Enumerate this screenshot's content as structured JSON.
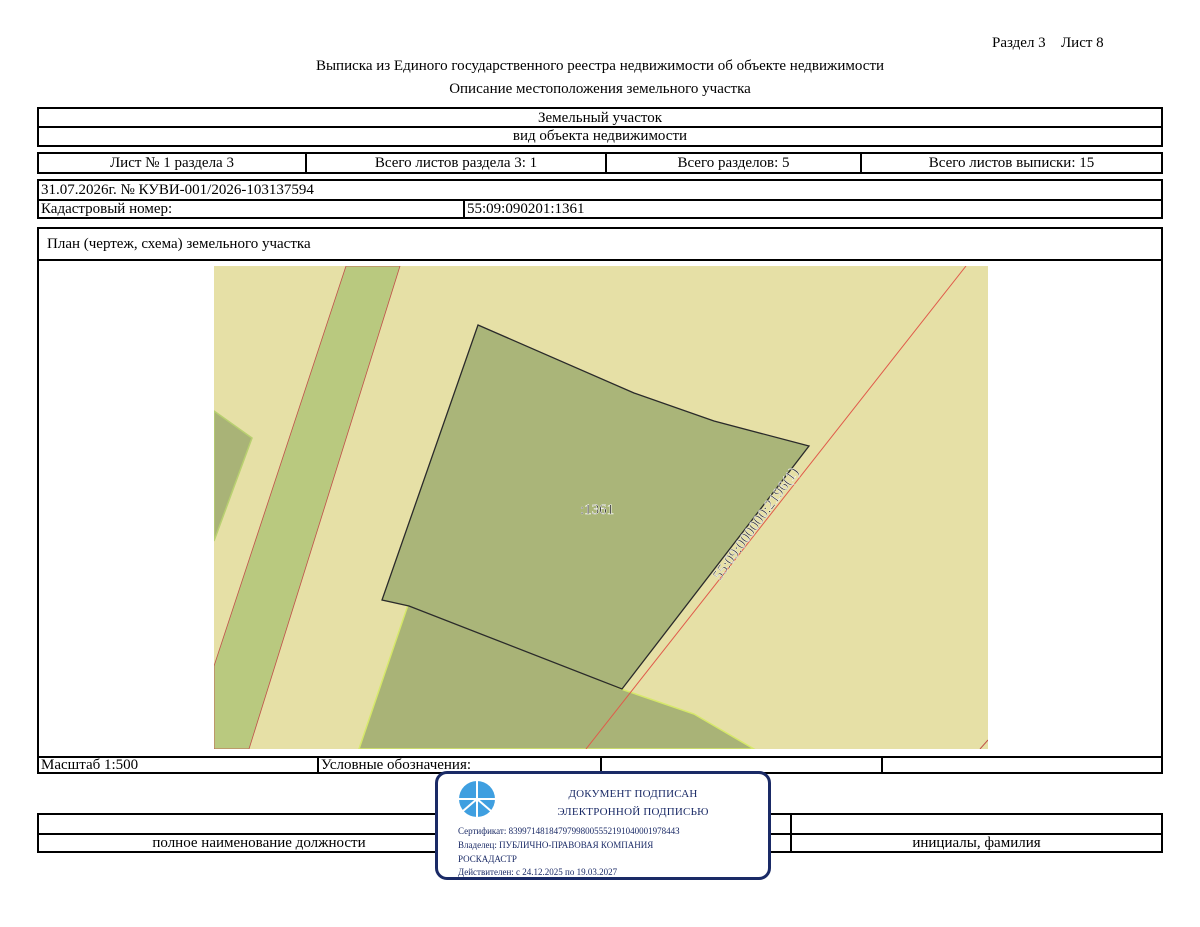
{
  "header": {
    "section_label": "Раздел 3",
    "sheet_label": "Лист 8",
    "title": "Выписка из Единого государственного реестра недвижимости об объекте недвижимости",
    "subtitle": "Описание местоположения земельного участка"
  },
  "object": {
    "type_value": "Земельный участок",
    "type_caption": "вид объекта недвижимости"
  },
  "sheets": {
    "sheet_no": "Лист № 1 раздела 3",
    "total_section_sheets": "Всего листов раздела 3: 1",
    "total_sections": "Всего разделов: 5",
    "total_extract_sheets": "Всего листов выписки: 15"
  },
  "record": {
    "date_number": "31.07.2026г. № КУВИ-001/2026-103137594",
    "cadastral_label": "Кадастровый номер:",
    "cadastral_value": "55:09:090201:1361"
  },
  "plan": {
    "heading": "План (чертеж, схема) земельного участка",
    "parcel_label": ":1361",
    "line_label": "55:09:000000:2196(1)",
    "colors": {
      "background": "#e6e0a6",
      "road_strip": "#b9c97f",
      "parcel": "#aab579",
      "neighbor": "#a9b377",
      "boundary": "#2a2a2a",
      "red_line": "#e05a4a"
    }
  },
  "footer": {
    "scale": "Масштаб 1:500",
    "legend": "Условные обозначения:",
    "position_caption": "полное наименование должности",
    "name_caption": "инициалы, фамилия"
  },
  "stamp": {
    "line1": "ДОКУМЕНТ ПОДПИСАН",
    "line2": "ЭЛЕКТРОННОЙ ПОДПИСЬЮ",
    "certificate": "Сертификат: 8399714818479799800555219104000197844З",
    "owner_line1": "Владелец: ПУБЛИЧНО-ПРАВОВАЯ КОМПАНИЯ",
    "owner_line2": "РОСКАДАСТР",
    "valid": "Действителен: с 24.12.2025 по 19.03.2027",
    "emblem_icon": "emblem-icon"
  }
}
